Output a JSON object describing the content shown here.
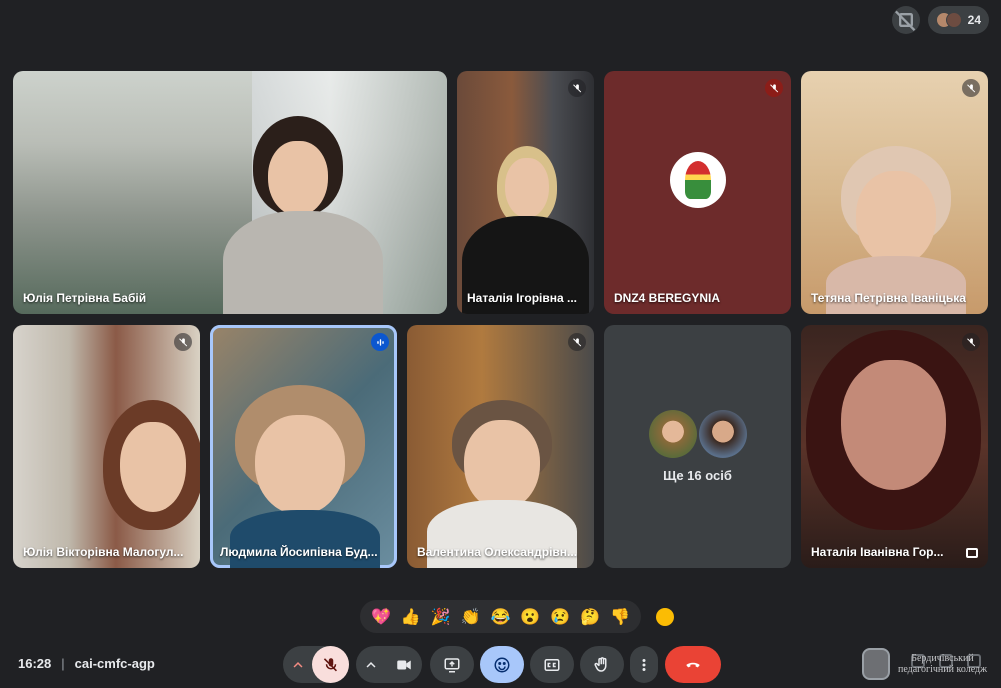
{
  "top_bar": {
    "participant_count": "24"
  },
  "tiles": [
    {
      "name": "Юлія Петрівна Бабій",
      "mic": "none"
    },
    {
      "name": "Наталія Ігорівна ...",
      "mic": "muted"
    },
    {
      "name": "DNZ4 BEREGYNIA",
      "mic": "muted-red"
    },
    {
      "name": "Тетяна Петрівна Іваніцька",
      "mic": "muted"
    },
    {
      "name": "Юлія Вікторівна Малогул...",
      "mic": "muted"
    },
    {
      "name": "Людмила Йосипівна Буд...",
      "mic": "speaking"
    },
    {
      "name": "Валентина Олександрівн...",
      "mic": "muted"
    },
    {
      "name": "Наталія Іванівна Гор...",
      "mic": "muted"
    }
  ],
  "others": {
    "label": "Ще 16 осіб"
  },
  "reactions": [
    "💖",
    "👍",
    "🎉",
    "👏",
    "😂",
    "😮",
    "😢",
    "🤔",
    "👎"
  ],
  "meeting": {
    "time": "16:28",
    "separator": "|",
    "code": "cai-cmfc-agp"
  },
  "colors": {
    "background": "#202124",
    "active_outline": "#a8c7fa",
    "end_call": "#ea4335",
    "mic_off": "#f9dedc"
  },
  "watermark": {
    "line1": "Бердичівський",
    "line2": "педагогічний коледж"
  }
}
